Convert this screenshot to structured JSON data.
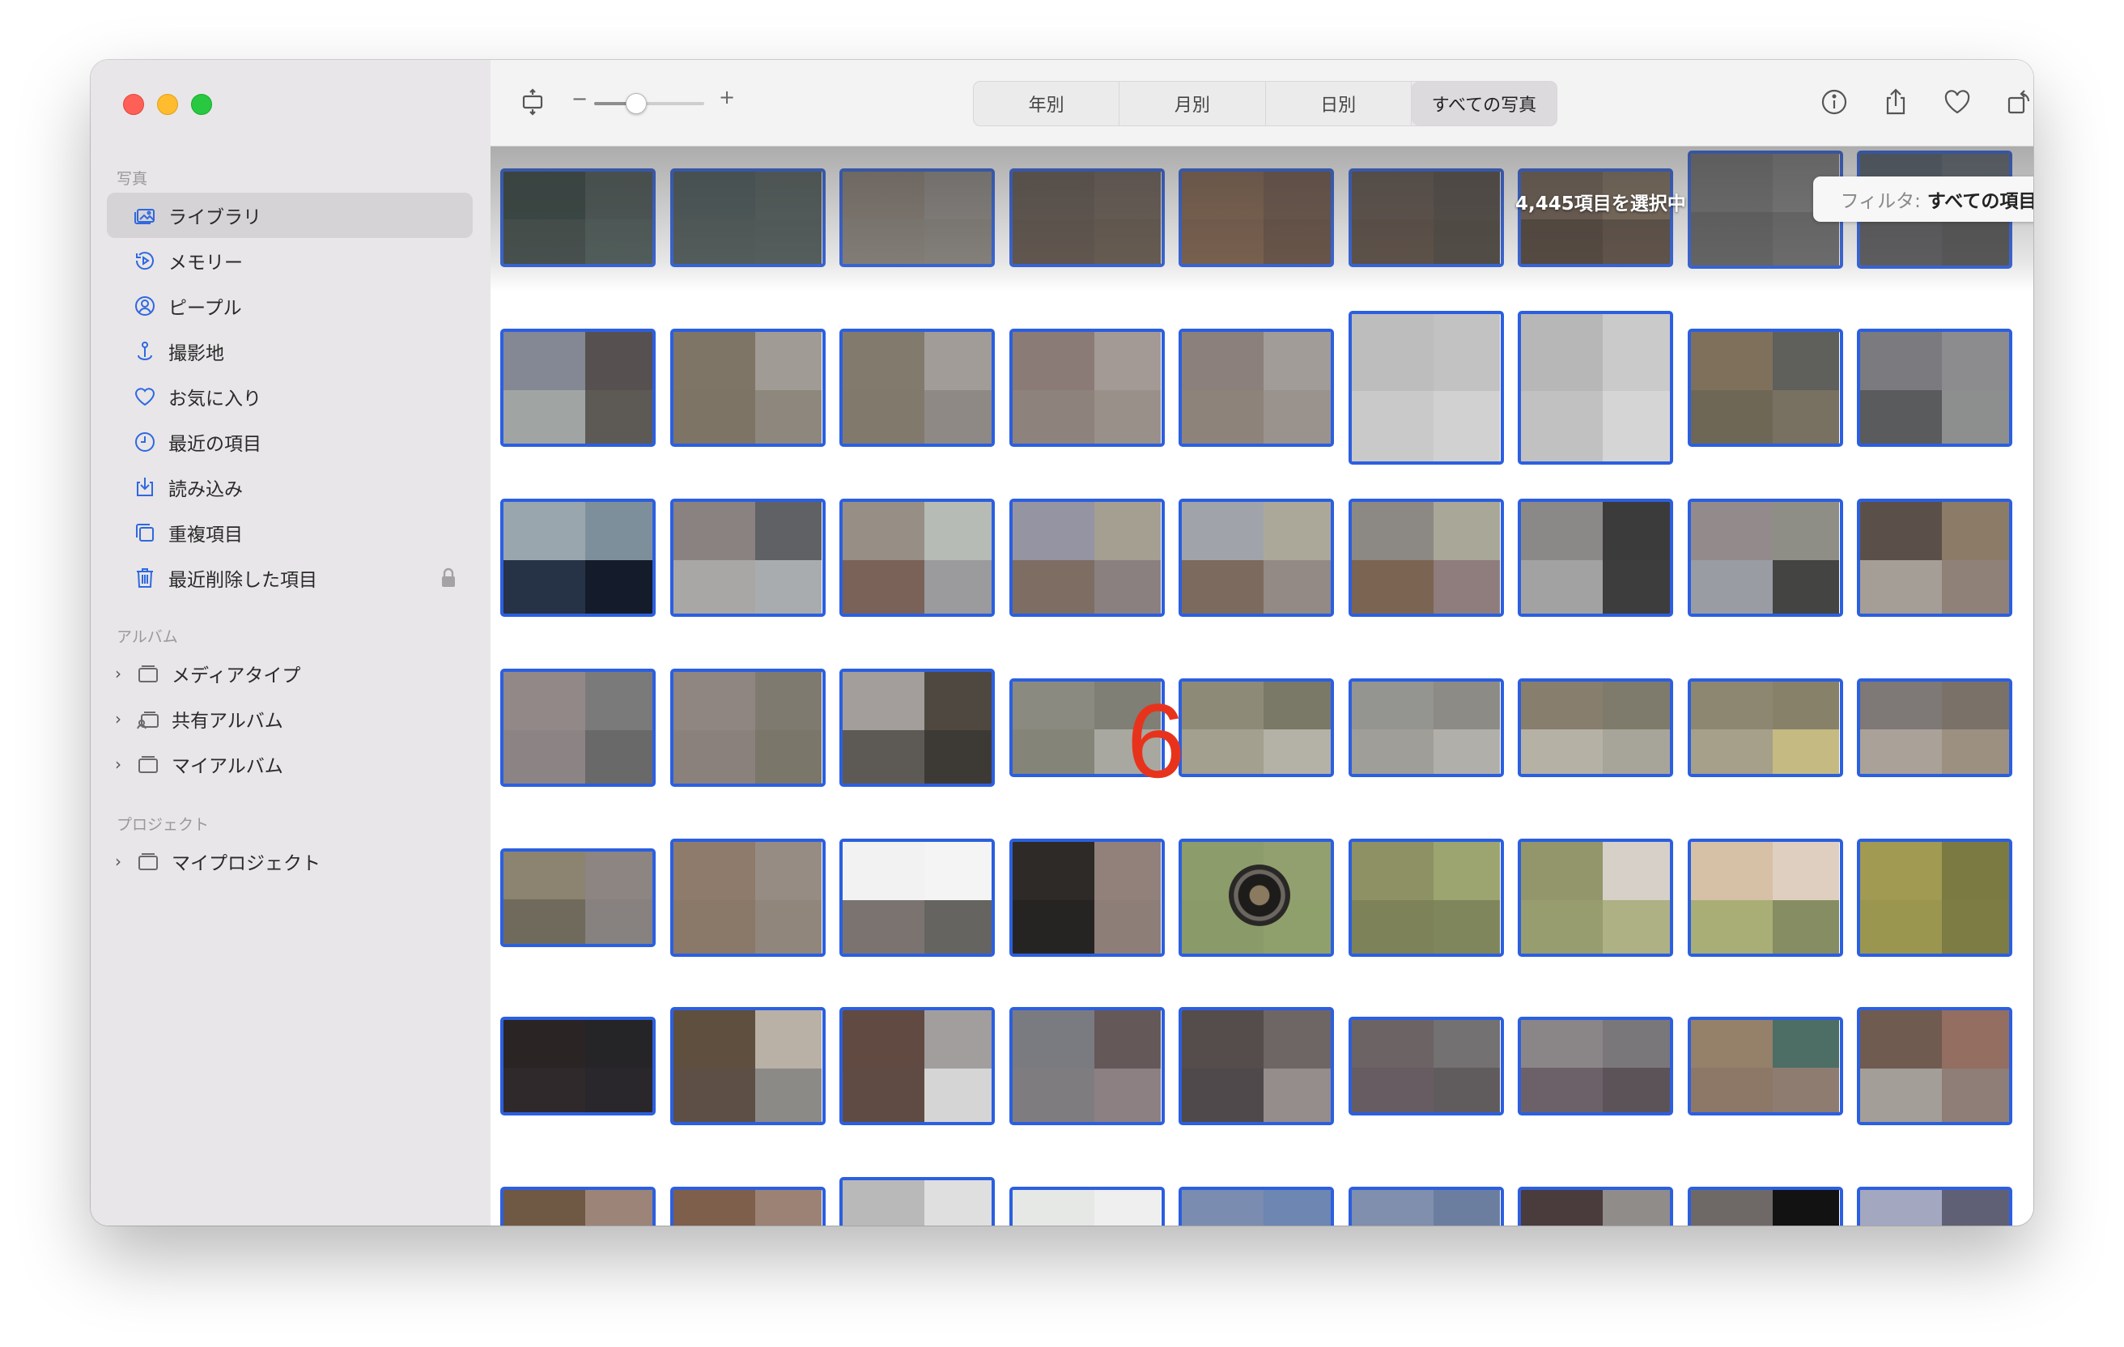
{
  "colors": {
    "accent": "#2c5fe0",
    "annotation": "#e8331c"
  },
  "sidebar": {
    "sections": [
      {
        "title": "写真",
        "items": [
          {
            "label": "ライブラリ",
            "icon": "library-icon",
            "active": true
          },
          {
            "label": "メモリー",
            "icon": "memories-icon"
          },
          {
            "label": "ピープル",
            "icon": "people-icon"
          },
          {
            "label": "撮影地",
            "icon": "places-icon"
          },
          {
            "label": "お気に入り",
            "icon": "heart-icon"
          },
          {
            "label": "最近の項目",
            "icon": "clock-icon"
          },
          {
            "label": "読み込み",
            "icon": "import-icon"
          },
          {
            "label": "重複項目",
            "icon": "duplicates-icon"
          },
          {
            "label": "最近削除した項目",
            "icon": "trash-icon",
            "locked": true
          }
        ]
      },
      {
        "title": "アルバム",
        "items": [
          {
            "label": "メディアタイプ",
            "icon": "folder-icon"
          },
          {
            "label": "共有アルバム",
            "icon": "shared-folder-icon"
          },
          {
            "label": "マイアルバム",
            "icon": "folder-icon"
          }
        ]
      },
      {
        "title": "プロジェクト",
        "items": [
          {
            "label": "マイプロジェクト",
            "icon": "folder-icon"
          }
        ]
      }
    ]
  },
  "toolbar": {
    "zoom_minus": "−",
    "zoom_plus": "+",
    "zoom_level": 0.35,
    "segments": [
      "年別",
      "月別",
      "日別",
      "すべての写真"
    ],
    "active_segment": 3,
    "right_icons": [
      "info-icon",
      "share-icon",
      "favorite-icon",
      "rotate-icon",
      "search-icon"
    ]
  },
  "status": {
    "selected_count": "4,445項目を選択中"
  },
  "filter": {
    "label": "フィルタ:",
    "value": "すべての項目"
  },
  "annotation": "6",
  "grid": {
    "rows": [
      [
        {
          "c": [
            "#2e3e3a",
            "#45514f",
            "#3c4744",
            "#485753"
          ]
        },
        {
          "c": [
            "#465454",
            "#4e5a58",
            "#4a5654",
            "#4c5856"
          ]
        },
        {
          "c": [
            "#857b71",
            "#8a8681",
            "#837d75",
            "#858079"
          ]
        },
        {
          "c": [
            "#5d5149",
            "#675a50",
            "#5b4f46",
            "#625549"
          ]
        },
        {
          "c": [
            "#7d5e48",
            "#6a5244",
            "#785a45",
            "#654d3f"
          ]
        },
        {
          "c": [
            "#5a4d45",
            "#4e4640",
            "#57493f",
            "#4a433b"
          ]
        },
        {
          "c": [
            "#6b5a4c",
            "#7b6a58",
            "#4d4036",
            "#5a4b40"
          ]
        },
        {
          "c": [
            "#6e6e6e",
            "#7a7a7a",
            "#5f5f5f",
            "#686868"
          ]
        },
        {
          "c": [
            "#4e5a66",
            "#5c6570",
            "#56565a",
            "#4f4f50"
          ]
        }
      ],
      [
        {
          "c": [
            "#848794",
            "#565051",
            "#a0a5a4",
            "#5d5a55"
          ]
        },
        {
          "c": [
            "#7f7566",
            "#a09b95",
            "#7d7466",
            "#8d877d"
          ]
        },
        {
          "c": [
            "#837a6e",
            "#a19c98",
            "#82796d",
            "#8f8985"
          ]
        },
        {
          "c": [
            "#8a7b76",
            "#a39a95",
            "#8e827c",
            "#999089"
          ]
        },
        {
          "c": [
            "#8b807b",
            "#a29c98",
            "#8d837b",
            "#9a928c"
          ]
        },
        {
          "c": [
            "#bdbdbd",
            "#c2c2c2",
            "#c9c9c9",
            "#d1d1d1"
          ]
        },
        {
          "c": [
            "#b7b7b7",
            "#cacaca",
            "#c1c1c1",
            "#d5d5d5"
          ]
        },
        {
          "c": [
            "#7f705c",
            "#5f5f5b",
            "#6f6756",
            "#787061"
          ]
        },
        {
          "c": [
            "#7a7a7f",
            "#8c8c8e",
            "#5a5b5c",
            "#8d8e8e"
          ]
        }
      ],
      [
        {
          "c": [
            "#9aa6ae",
            "#7e8f9c",
            "#263245",
            "#141c2b"
          ]
        },
        {
          "c": [
            "#898280",
            "#5f6165",
            "#a9a6a6",
            "#a9acae"
          ]
        },
        {
          "c": [
            "#978f86",
            "#b6bcb5",
            "#7a6258",
            "#9b9b9d"
          ]
        },
        {
          "c": [
            "#9494a2",
            "#a59f91",
            "#7d6d63",
            "#8b8080"
          ]
        },
        {
          "c": [
            "#a0a4aa",
            "#aca899",
            "#7d6a5e",
            "#938a86"
          ]
        },
        {
          "c": [
            "#8c8985",
            "#a9a797",
            "#7c6452",
            "#8e7d7c"
          ]
        },
        {
          "c": [
            "#8a8988",
            "#3b3b3b",
            "#a3a2a2",
            "#3d3d3d"
          ]
        },
        {
          "c": [
            "#928a8b",
            "#8e8e87",
            "#9a9ca4",
            "#444442"
          ]
        },
        {
          "c": [
            "#5b5049",
            "#8c7b66",
            "#a59e96",
            "#8f8178"
          ]
        }
      ],
      [
        {
          "c": [
            "#928887",
            "#7a7a7b",
            "#8c8384",
            "#686968"
          ]
        },
        {
          "c": [
            "#8f8581",
            "#7f7a70",
            "#8a817d",
            "#7a7669"
          ]
        },
        {
          "c": [
            "#a39e9b",
            "#4e4840",
            "#5d5955",
            "#3d3a36"
          ]
        },
        {
          "c": [
            "#8b8a80",
            "#7f7f75",
            "#858479",
            "#a8a8a0"
          ]
        },
        {
          "c": [
            "#8e8a78",
            "#7a7866",
            "#a3a090",
            "#b4b1a6"
          ]
        },
        {
          "c": [
            "#949490",
            "#8d8b86",
            "#a09e98",
            "#b1afaa"
          ]
        },
        {
          "c": [
            "#887e6d",
            "#7e7b6c",
            "#b5b1a5",
            "#a7a59a"
          ]
        },
        {
          "c": [
            "#8d8670",
            "#878169",
            "#a6a08a",
            "#c4ba82"
          ]
        },
        {
          "c": [
            "#7e7876",
            "#7a7169",
            "#aaa298",
            "#9c9080"
          ]
        }
      ],
      [
        {
          "c": [
            "#8c8470",
            "#8c8582",
            "#6f6a5c",
            "#878180"
          ]
        },
        {
          "c": [
            "#8e7b6c",
            "#978c84",
            "#8a7868",
            "#90867c"
          ]
        },
        {
          "c": [
            "#f2f2f2",
            "#f4f4f4",
            "#7a7370",
            "#666461"
          ]
        },
        {
          "c": [
            "#2d2a28",
            "#91817a",
            "#262423",
            "#8d7e77"
          ]
        },
        {
          "c": [
            "#8c9c6a",
            "#92a070",
            "#8a9a68",
            "#90a06c"
          ]
        },
        {
          "c": [
            "#8d9163",
            "#9ca56f",
            "#7d8258",
            "#80865c"
          ]
        },
        {
          "c": [
            "#92966a",
            "#d6d0c8",
            "#979d6e",
            "#adb183"
          ]
        },
        {
          "c": [
            "#d6c0a6",
            "#dfcfc0",
            "#a8ae76",
            "#868d62"
          ]
        },
        {
          "c": [
            "#a09a52",
            "#7b7a42",
            "#9a9650",
            "#7d7c44"
          ]
        }
      ],
      [
        {
          "c": [
            "#2a2424",
            "#252427",
            "#2f292c",
            "#29272b"
          ]
        },
        {
          "c": [
            "#5e4f3f",
            "#b9b0a6",
            "#5d4f45",
            "#8c8a86"
          ]
        },
        {
          "c": [
            "#614a42",
            "#a19e9d",
            "#604b44",
            "#d6d5d5"
          ]
        },
        {
          "c": [
            "#7a7b80",
            "#655858",
            "#7f7c80",
            "#8c8083"
          ]
        },
        {
          "c": [
            "#554d4b",
            "#6e6565",
            "#4f494b",
            "#958c8c"
          ]
        },
        {
          "c": [
            "#6c6364",
            "#737171",
            "#675c61",
            "#605b5d"
          ]
        },
        {
          "c": [
            "#8a8587",
            "#7a777a",
            "#6d6169",
            "#5c5358"
          ]
        },
        {
          "c": [
            "#95806a",
            "#4c6e64",
            "#8d7767",
            "#8e7c70"
          ]
        },
        {
          "c": [
            "#6f5b50",
            "#946e60",
            "#a39e97",
            "#8e7e77"
          ]
        }
      ],
      [
        {
          "c": [
            "#6f5844",
            "#9c8578",
            "#6a5444",
            "#937c6f"
          ]
        },
        {
          "c": [
            "#7d5f4c",
            "#9b8275",
            "#7a5d4a",
            "#968073"
          ]
        },
        {
          "c": [
            "#b9b9b9",
            "#dfdfdf",
            "#c5c5c5",
            "#e5e5e5"
          ]
        },
        {
          "c": [
            "#e6e8e6",
            "#eeefee",
            "#e8eae8",
            "#eff0ef"
          ]
        },
        {
          "c": [
            "#7a8cb0",
            "#6d86b2",
            "#8094b8",
            "#7a90ba"
          ]
        },
        {
          "c": [
            "#7f8fad",
            "#6b7ea0",
            "#8795b2",
            "#7487a8"
          ]
        },
        {
          "c": [
            "#4a3b3d",
            "#908c8a",
            "#4e4242",
            "#8e8a88"
          ]
        },
        {
          "c": [
            "#6e6966",
            "#121212",
            "#7a7572",
            "#1b1b1b"
          ]
        },
        {
          "c": [
            "#a3a7c0",
            "#5f6075",
            "#a9adc5",
            "#66677b"
          ]
        }
      ]
    ]
  }
}
